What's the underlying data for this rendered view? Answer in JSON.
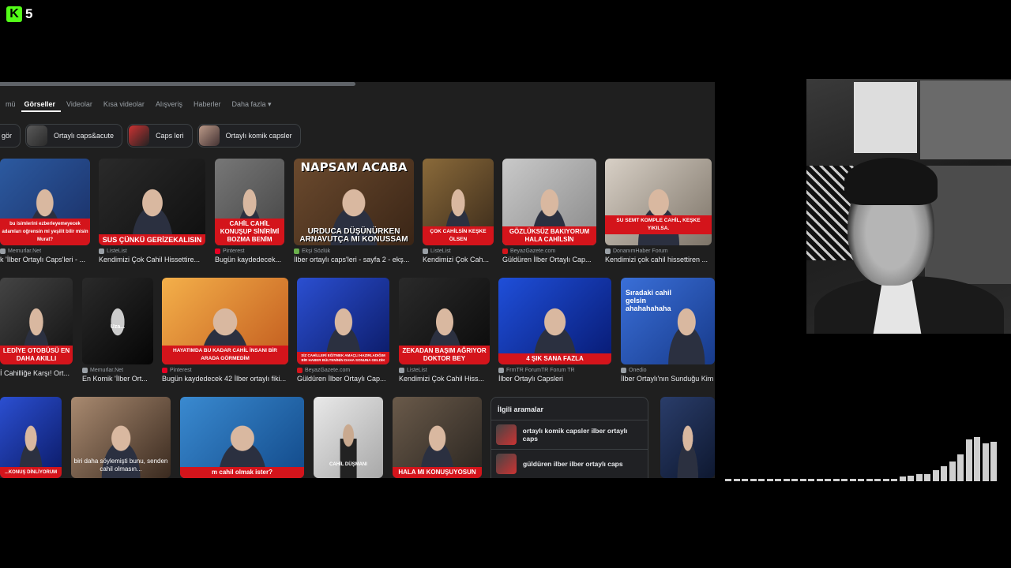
{
  "overlay": {
    "platform_icon": "kick-logo-icon",
    "logo_letter": "K",
    "viewer_count": "5"
  },
  "browser": {
    "tabs": [
      {
        "label": "mü",
        "active": false
      },
      {
        "label": "Görseller",
        "active": true
      },
      {
        "label": "Videolar",
        "active": false
      },
      {
        "label": "Kısa videolar",
        "active": false
      },
      {
        "label": "Alışveriş",
        "active": false
      },
      {
        "label": "Haberler",
        "active": false
      },
      {
        "label": "Daha fazla ▾",
        "active": false
      }
    ],
    "chips": [
      "göр",
      "Ortaylı caps&acute",
      "Caps leri",
      "Ortaylı komik capsler"
    ],
    "chip_first": "gör",
    "cards": [
      {
        "source": "Memurlar.Net",
        "title": "k 'İlber Ortaylı Caps'leri - ...",
        "caption": "bu isimlerini ezberleyemeyecek adamları oğrensin mi yeşilit bilir misin Murat?"
      },
      {
        "source": "ListeList",
        "title": "Kendimizi Çok Cahil Hissettire...",
        "caption": "SUS ÇÜNKÜ GERİZEKALISIN"
      },
      {
        "source": "Pinterest",
        "title": "Bugün kaydedecek...",
        "caption": "CAHİL CAHİL KONUŞUP SİNİRİMİ BOZMA BENİM"
      },
      {
        "source": "Ekşi Sözlük",
        "title": "İlber ortaylı caps'leri - sayfa 2 - ekş...",
        "topcap": "NAPSAM ACABA",
        "caption": "URDUCA DÜŞÜNÜRKEN ARNAVUTÇA MI KONUSSAM"
      },
      {
        "source": "ListeList",
        "title": "Kendimizi Çok Cah...",
        "caption": "ÇOK CAHİLSİN KEŞKE ÖLSEN"
      },
      {
        "source": "BeyazGazete.com",
        "title": "Güldüren İlber Ortaylı Cap...",
        "caption": "GÖZLÜKSÜZ BAKIYORUM HALA CAHİLSİN"
      },
      {
        "source": "DonanımHaber Forum",
        "title": "Kendimizi çok cahil hissettiren ...",
        "caption": "SU SEMT KOMPLE CAHİL, KEŞKE YIKILSA."
      },
      {
        "source": "",
        "title": "İ Cahilliğe Karşı! Ort...",
        "caption": "LEDİYE OTOBÜSÜ EN DAHA AKILLI"
      },
      {
        "source": "Memurlar.Net",
        "title": "En Komik 'İlber Ort...",
        "caption": "Uza..."
      },
      {
        "source": "Pinterest",
        "title": "Bugün kaydedecek 42 İlber ortaylı fiki...",
        "caption": "HAYATIMDA BU KADAR CAHİL İNSANI BİR ARADA GÖRMEDİM"
      },
      {
        "source": "BeyazGazete.com",
        "title": "Güldüren İlber Ortaylı Cap...",
        "caption": "SİZ CAHİLLERİ EĞİTMEK AMAÇLI HAZIRLADIĞIM BİR HABER BÜLTENİNİN DAHA SONUNA GELDİK"
      },
      {
        "source": "ListeList",
        "title": "Kendimizi Çok Cahil Hiss...",
        "caption": "ZEKADAN BAŞIM AĞRIYOR DOKTOR BEY"
      },
      {
        "source": "FrmTR ForumTR Forum TR",
        "title": "İlber Ortaylı Capsleri",
        "caption": "4 ŞIK SANA FAZLA"
      },
      {
        "source": "Onedio",
        "title": "İlber Ortaylı'nın Sunduğu Kim",
        "caption": "Sıradaki cahil gelsin ahahahahaha"
      },
      {
        "caption": "...KONUŞ DİNLİYORUM"
      },
      {
        "caption": "biri daha söylemişti bunu, senden cahil olmasın..."
      },
      {
        "caption": "m cahil olmak ister?"
      },
      {
        "caption": "CAHİL DÜŞMANI"
      },
      {
        "caption": "HALA MI KONUŞUYOSUN"
      },
      {
        "caption": ""
      }
    ],
    "related": {
      "header": "İlgili aramalar",
      "items": [
        "ortaylı komik capsler ilber ortaylı caps",
        "güldüren ilber ilber ortaylı caps"
      ]
    }
  },
  "audio_levels": [
    0.05,
    0.05,
    0.05,
    0.05,
    0.05,
    0.05,
    0.05,
    0.05,
    0.05,
    0.05,
    0.05,
    0.05,
    0.05,
    0.05,
    0.05,
    0.05,
    0.05,
    0.05,
    0.05,
    0.05,
    0.05,
    0.1,
    0.12,
    0.15,
    0.15,
    0.22,
    0.3,
    0.4,
    0.55,
    0.85,
    0.9,
    0.78,
    0.8
  ]
}
